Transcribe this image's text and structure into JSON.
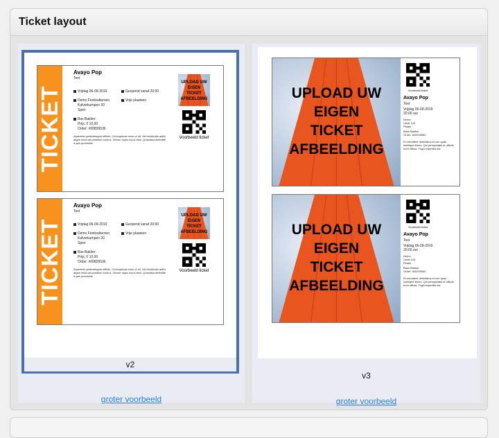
{
  "panel": {
    "title": "Ticket layout"
  },
  "options": [
    {
      "label": "v2",
      "link": "groter voorbeeld",
      "selected": true
    },
    {
      "label": "v3",
      "link": "groter voorbeeld",
      "selected": false
    }
  ],
  "ticket": {
    "stripe_text": "TICKET",
    "event_name": "Avayo Pop",
    "event_sub": "Test",
    "date": "Vrijdag 06-09-2019",
    "open": "Geopend vanaf 20:00",
    "venue": "Demo Festivalterrein",
    "street": "Kalverkampen 20",
    "city": "Spier",
    "seating": "Vrije plaatsen",
    "buyer": "Bas Bakker",
    "price": "Prijs: € 10,00",
    "order": "Order: #00826536",
    "disclaimer": "Aspiciens pellentesque officiis. Concupiscat enim ut sit. Vel incidiculis adfui atque iniria ad proelium sumus. Serum hujus locus eosi. Quasitisa delentite a quo proveniat.",
    "qr_caption": "Voorbeeld ticket",
    "v3_date": "Vrijdag 06-09-2019",
    "v3_time": "20:00 uur",
    "v3_venue": "Demo",
    "v3_street": "Umal 143",
    "v3_city": "Plaats",
    "v3_buyer": "Bass Bakker",
    "v3_order": "Order: #00206960",
    "v3_disclaimer": "Et crevatent delectibus et con quas similique libero. Qui perspiciatis et officiis eum officia. Fuga expedita est."
  },
  "upload_image": {
    "lines": [
      "UPLOAD UW",
      "EIGEN",
      "TICKET",
      "AFBEELDING"
    ]
  },
  "colors": {
    "accent_orange": "#f7921e",
    "select_border": "#4a6fad",
    "link": "#2a7fd4"
  }
}
